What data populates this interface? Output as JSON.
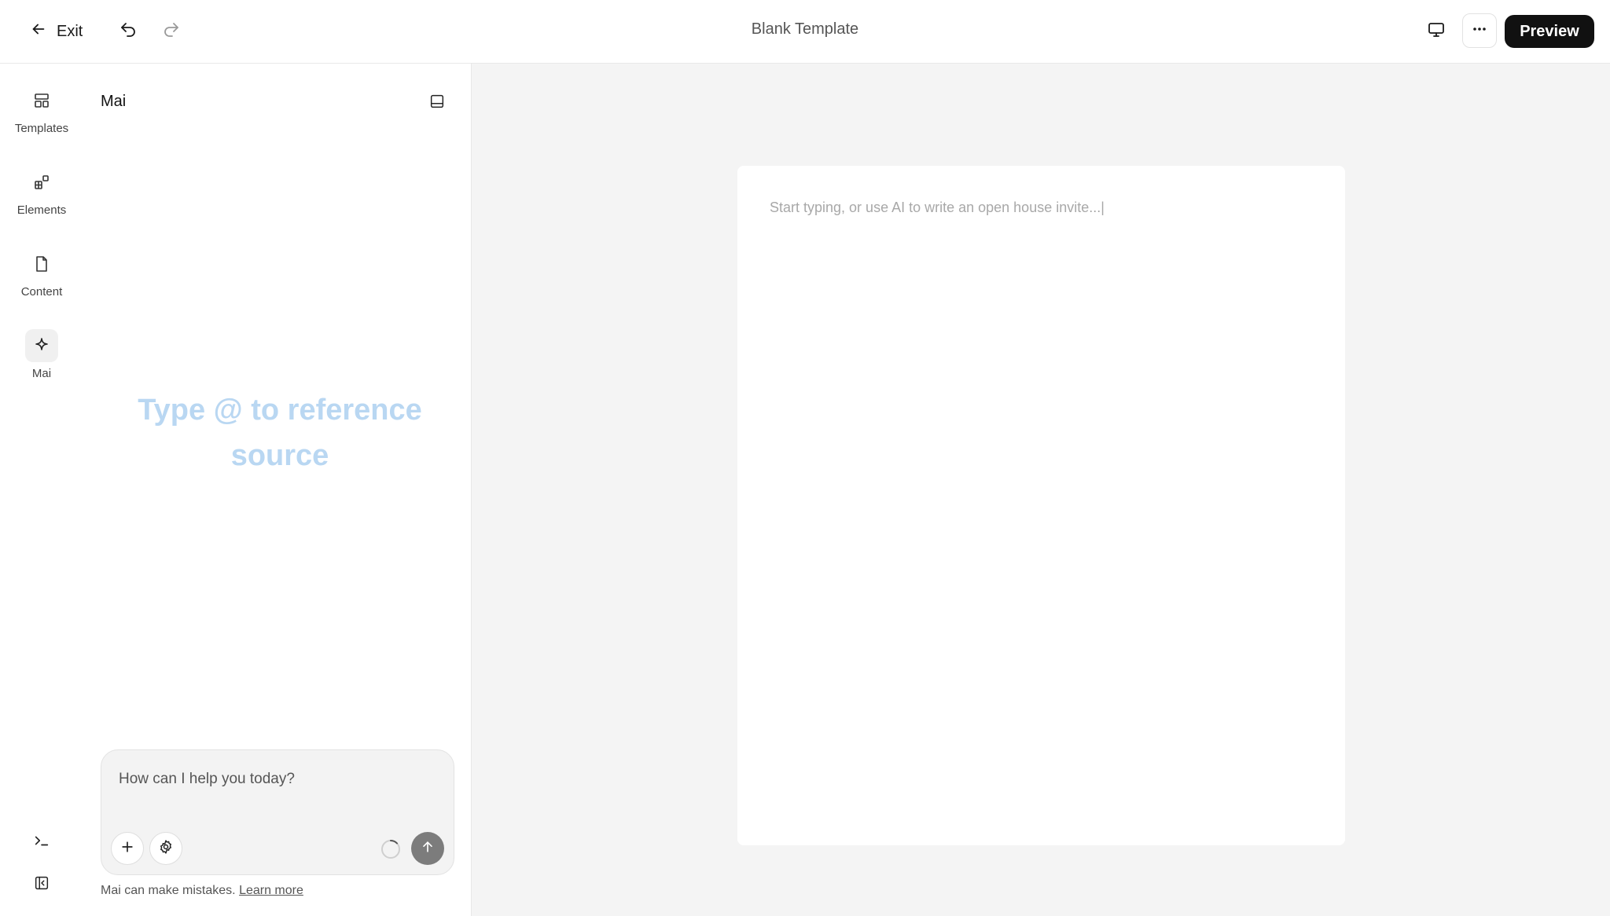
{
  "topbar": {
    "exit_label": "Exit",
    "title": "Blank Template",
    "preview_label": "Preview",
    "icons": {
      "back": "arrow-left-icon",
      "undo": "undo-icon",
      "redo": "redo-icon",
      "device": "monitor-icon",
      "more": "more-horizontal-icon"
    }
  },
  "rail": {
    "items": [
      {
        "label": "Templates",
        "icon": "templates-icon",
        "active": false
      },
      {
        "label": "Elements",
        "icon": "elements-icon",
        "active": false
      },
      {
        "label": "Content",
        "icon": "document-icon",
        "active": false
      },
      {
        "label": "Mai",
        "icon": "sparkle-icon",
        "active": true
      }
    ],
    "bottom_icons": [
      "terminal-icon",
      "collapse-sidebar-icon"
    ]
  },
  "panel": {
    "title": "Mai",
    "hint": "Type @ to reference source",
    "composer": {
      "placeholder": "How can I help you today?",
      "value": ""
    },
    "disclaimer": "Mai can make mistakes.",
    "learn_more": "Learn more"
  },
  "canvas": {
    "placeholder": "Start typing, or use AI to write an open house invite...|"
  },
  "colors": {
    "preview_button_bg": "#111111",
    "hint_text": "#b9d7f2",
    "canvas_bg": "#f4f4f4",
    "send_button": "#7c7c7c"
  }
}
